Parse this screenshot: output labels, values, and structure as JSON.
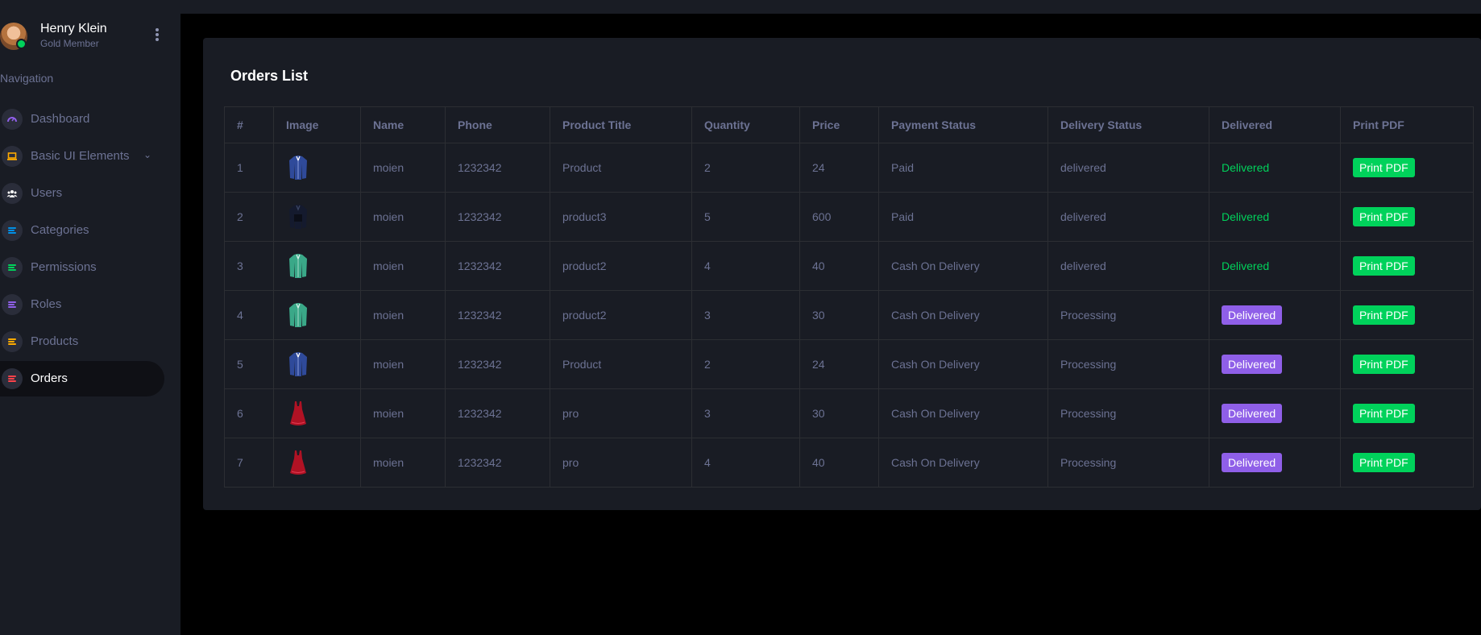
{
  "profile": {
    "name": "Henry Klein",
    "role": "Gold Member"
  },
  "nav": {
    "title": "Navigation",
    "items": [
      {
        "label": "Dashboard",
        "icon": "speedometer-icon",
        "color": "#8f5fe8"
      },
      {
        "label": "Basic UI Elements",
        "icon": "laptop-icon",
        "color": "#ffab00"
      },
      {
        "label": "Users",
        "icon": "users-icon",
        "color": "#ffffff"
      },
      {
        "label": "Categories",
        "icon": "list-icon",
        "color": "#0090e7"
      },
      {
        "label": "Permissions",
        "icon": "list-icon",
        "color": "#00d25b"
      },
      {
        "label": "Roles",
        "icon": "list-icon",
        "color": "#8f5fe8"
      },
      {
        "label": "Products",
        "icon": "list-icon",
        "color": "#ffab00"
      },
      {
        "label": "Orders",
        "icon": "list-icon",
        "color": "#fc424a"
      }
    ]
  },
  "orders": {
    "title": "Orders List",
    "columns": [
      "#",
      "Image",
      "Name",
      "Phone",
      "Product Title",
      "Quantity",
      "Price",
      "Payment Status",
      "Delivery Status",
      "Delivered",
      "Print PDF"
    ],
    "rows": [
      {
        "num": "1",
        "image": "blue-shirt",
        "name": "moien",
        "phone": "1232342",
        "product": "Product",
        "quantity": "2",
        "price": "24",
        "payment": "Paid",
        "delivery": "delivered",
        "delivered": "Delivered",
        "delivered_style": "text",
        "print": "Print PDF"
      },
      {
        "num": "2",
        "image": "black-shirt",
        "name": "moien",
        "phone": "1232342",
        "product": "product3",
        "quantity": "5",
        "price": "600",
        "payment": "Paid",
        "delivery": "delivered",
        "delivered": "Delivered",
        "delivered_style": "text",
        "print": "Print PDF"
      },
      {
        "num": "3",
        "image": "green-shirt",
        "name": "moien",
        "phone": "1232342",
        "product": "product2",
        "quantity": "4",
        "price": "40",
        "payment": "Cash On Delivery",
        "delivery": "delivered",
        "delivered": "Delivered",
        "delivered_style": "text",
        "print": "Print PDF"
      },
      {
        "num": "4",
        "image": "green-shirt",
        "name": "moien",
        "phone": "1232342",
        "product": "product2",
        "quantity": "3",
        "price": "30",
        "payment": "Cash On Delivery",
        "delivery": "Processing",
        "delivered": "Delivered",
        "delivered_style": "button",
        "print": "Print PDF"
      },
      {
        "num": "5",
        "image": "blue-shirt",
        "name": "moien",
        "phone": "1232342",
        "product": "Product",
        "quantity": "2",
        "price": "24",
        "payment": "Cash On Delivery",
        "delivery": "Processing",
        "delivered": "Delivered",
        "delivered_style": "button",
        "print": "Print PDF"
      },
      {
        "num": "6",
        "image": "red-dress",
        "name": "moien",
        "phone": "1232342",
        "product": "pro",
        "quantity": "3",
        "price": "30",
        "payment": "Cash On Delivery",
        "delivery": "Processing",
        "delivered": "Delivered",
        "delivered_style": "button",
        "print": "Print PDF"
      },
      {
        "num": "7",
        "image": "red-dress",
        "name": "moien",
        "phone": "1232342",
        "product": "pro",
        "quantity": "4",
        "price": "40",
        "payment": "Cash On Delivery",
        "delivery": "Processing",
        "delivered": "Delivered",
        "delivered_style": "button",
        "print": "Print PDF"
      }
    ]
  },
  "colors": {
    "sidebar_bg": "#191c24",
    "card_bg": "#191c24",
    "text_muted": "#6c7293",
    "success": "#00d25b",
    "primary_purple": "#8f5fe8"
  }
}
